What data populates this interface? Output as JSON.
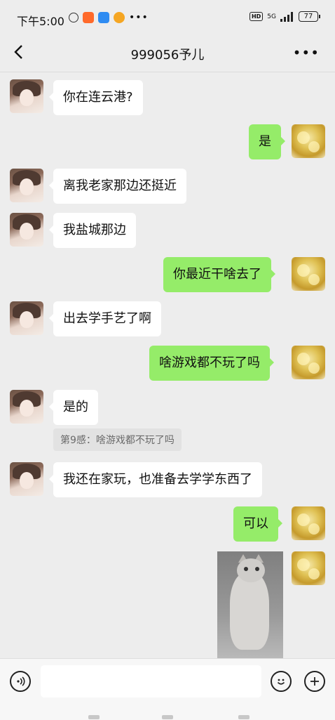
{
  "status_bar": {
    "time": "下午5:00",
    "network": "5G",
    "battery": "77",
    "hd_label": "HD"
  },
  "header": {
    "title": "999056予儿"
  },
  "messages": [
    {
      "side": "left",
      "text": "你在连云港?"
    },
    {
      "side": "right",
      "text": "是"
    },
    {
      "side": "left",
      "text": "离我老家那边还挺近"
    },
    {
      "side": "left",
      "text": "我盐城那边"
    },
    {
      "side": "right",
      "text": "你最近干啥去了"
    },
    {
      "side": "left",
      "text": "出去学手艺了啊"
    },
    {
      "side": "right",
      "text": "啥游戏都不玩了吗"
    },
    {
      "side": "left",
      "text": "是的"
    },
    {
      "side": "left",
      "text": "我还在家玩，也准备去学学东西了"
    },
    {
      "side": "right",
      "text": "可以"
    }
  ],
  "quote": {
    "text": "第9感：啥游戏都不玩了吗"
  },
  "input": {
    "placeholder": ""
  },
  "icons": {
    "voice": "voice-icon",
    "emoji": "emoji-icon",
    "plus": "plus-icon"
  },
  "colors": {
    "background": "#ededed",
    "outgoing_bubble": "#95ec69",
    "incoming_bubble": "#ffffff"
  }
}
